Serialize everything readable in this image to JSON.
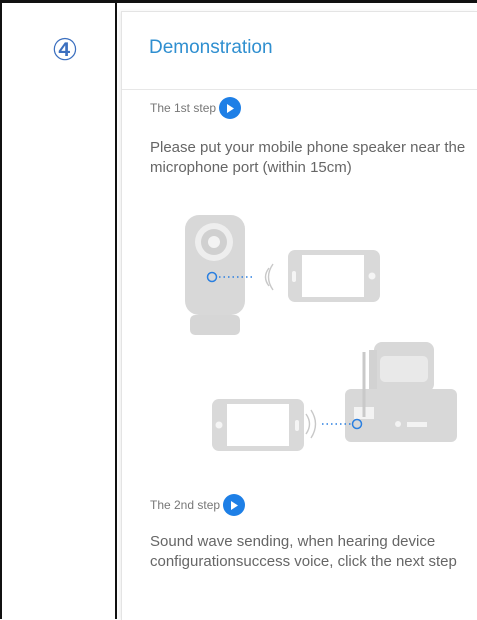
{
  "step_marker": "④",
  "demo": {
    "title": "Demonstration",
    "step1": {
      "label": "The 1st step",
      "text": "Please put your mobile phone speaker near the microphone port (within 15cm)"
    },
    "step2": {
      "label": "The 2nd step",
      "text": "Sound wave sending, when hearing device configurationsuccess voice, click the next step"
    }
  },
  "colors": {
    "title": "#2f8fd0",
    "play_button": "#1e7fe6",
    "marker": "#3b6fbf",
    "illustration": "#d6d6d6"
  }
}
